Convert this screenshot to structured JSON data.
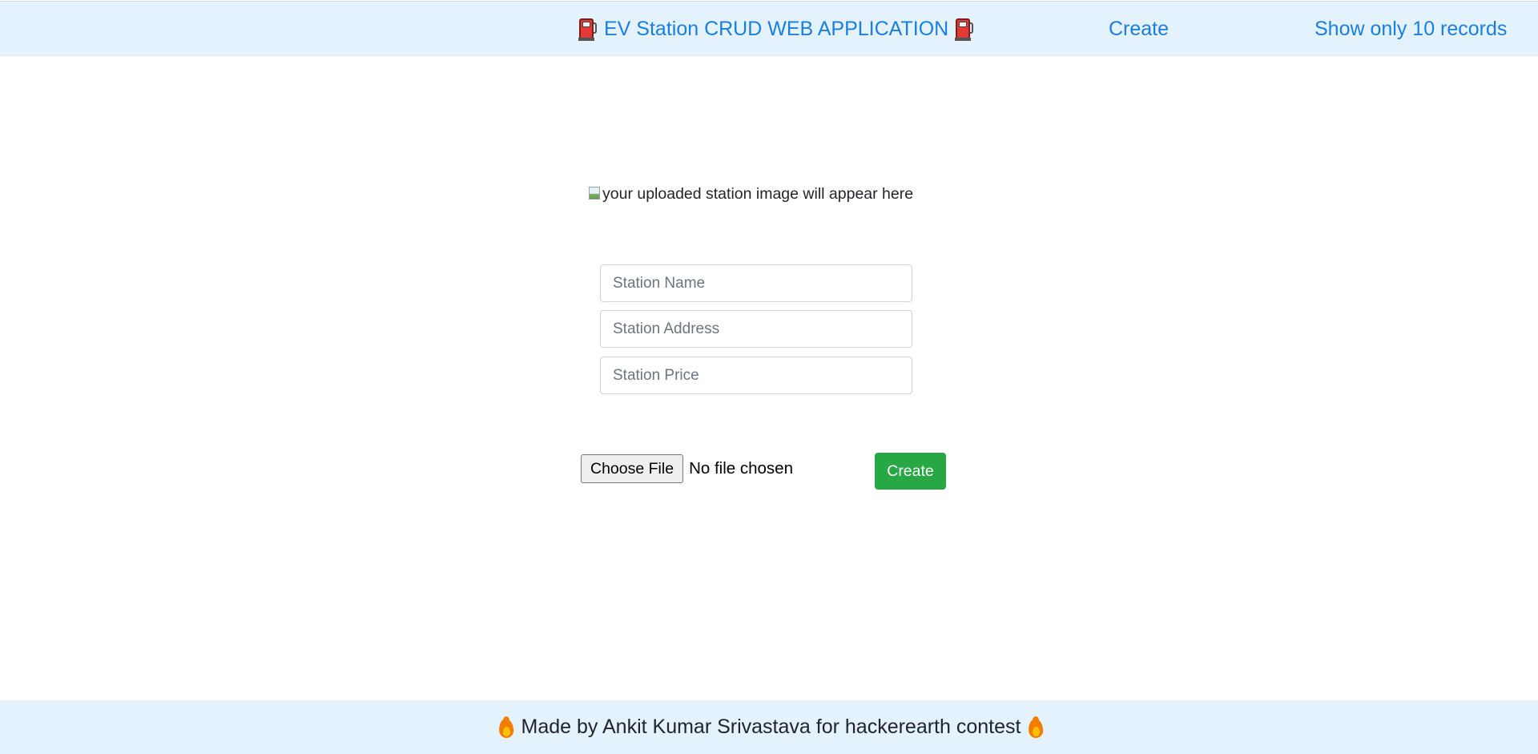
{
  "header": {
    "brand_label": "EV Station CRUD WEB APPLICATION",
    "brand_icon": "fuel-pump-icon",
    "nav": {
      "create_label": "Create",
      "records_label": "Show only 10 records"
    }
  },
  "main": {
    "image_placeholder_alt": "your uploaded station image will appear here",
    "form": {
      "name_placeholder": "Station Name",
      "name_value": "",
      "address_placeholder": "Station Address",
      "address_value": "",
      "price_placeholder": "Station Price",
      "price_value": "",
      "file_button_label": "Choose File",
      "file_status": "No file chosen",
      "submit_label": "Create"
    }
  },
  "footer": {
    "text": "Made by Ankit Kumar Srivastava for hackerearth contest",
    "icon": "fire-icon"
  },
  "colors": {
    "navbar_bg": "#e3f2fd",
    "link": "#1a7fe0",
    "success": "#28a745",
    "footer_bg": "#e3f2fd"
  }
}
